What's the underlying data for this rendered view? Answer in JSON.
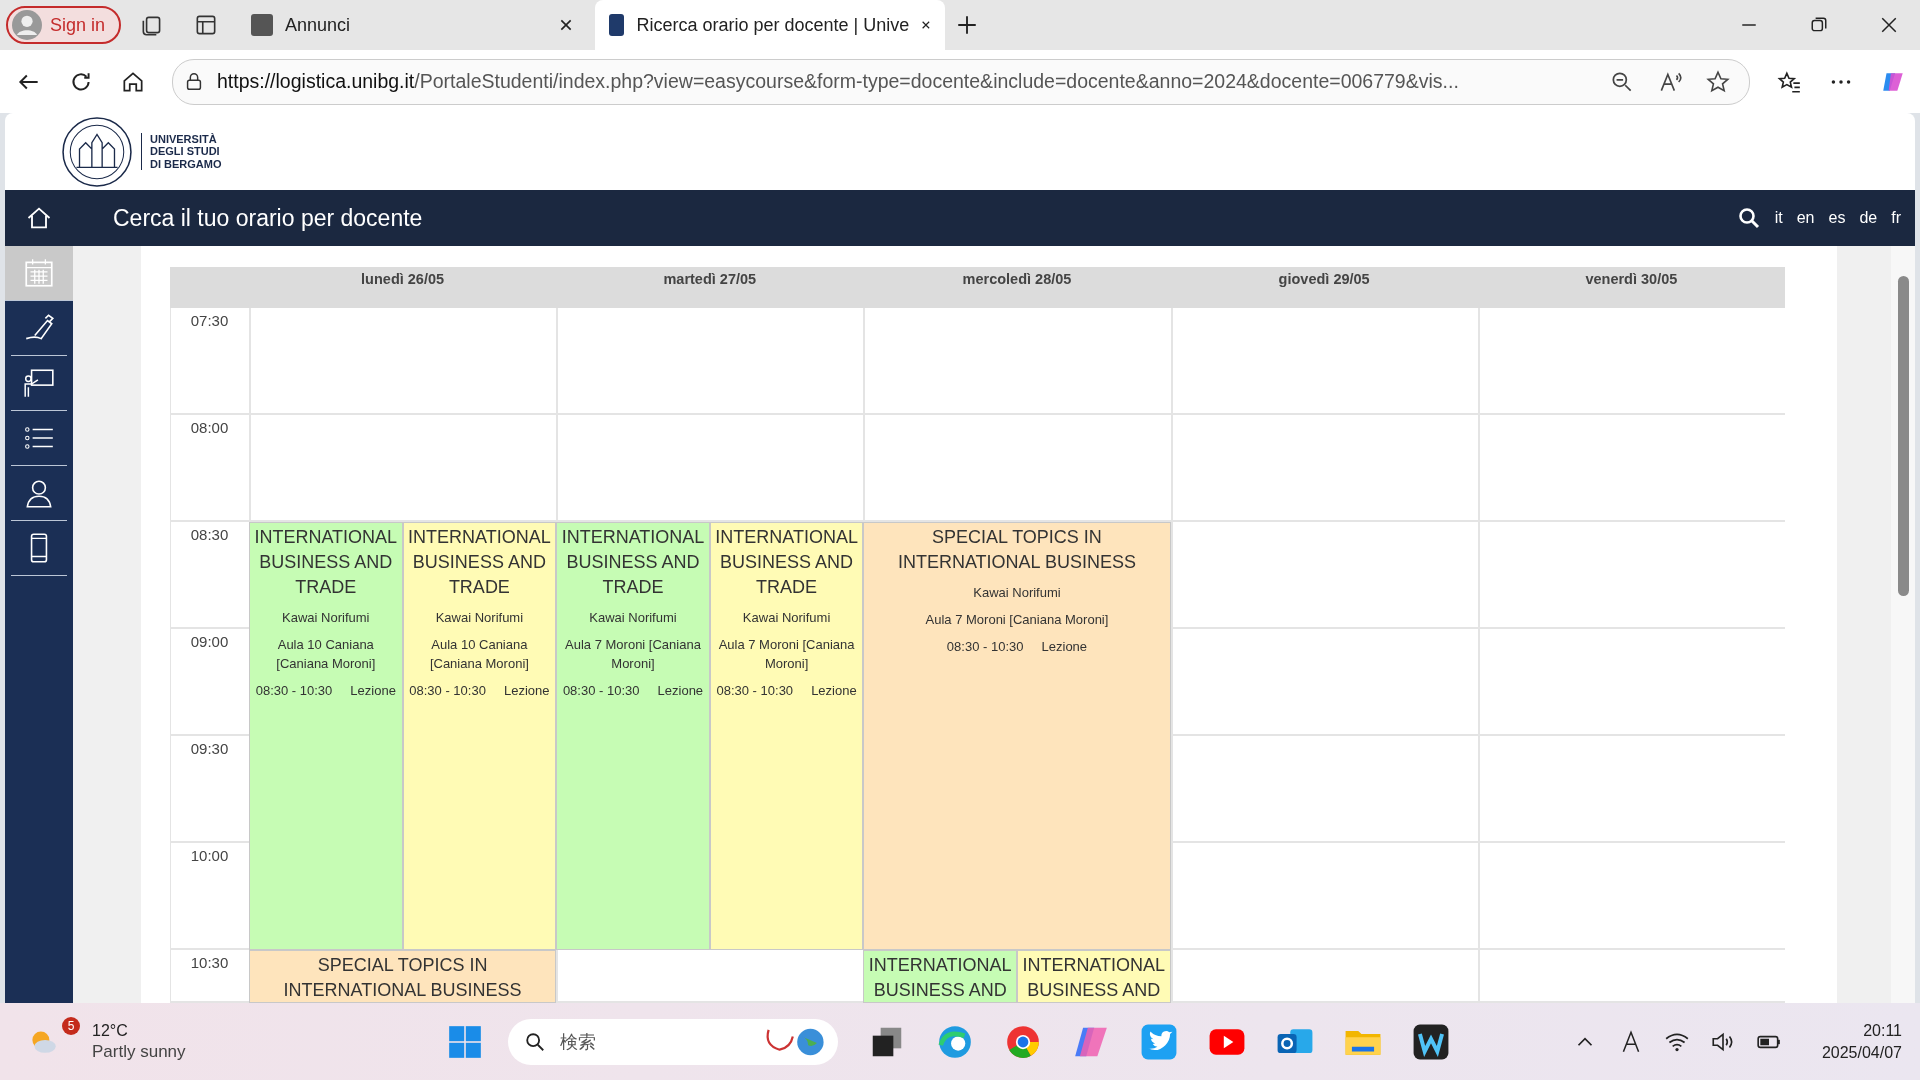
{
  "browser": {
    "sign_in": "Sign in",
    "tabs": [
      {
        "title": "Annunci",
        "selected": false
      },
      {
        "title": "Ricerca orario per docente | Unive",
        "selected": true
      }
    ],
    "url_host": "https://logistica.unibg.it",
    "url_rest": "/PortaleStudenti/index.php?view=easycourse&form-type=docente&include=docente&anno=2024&docente=006779&vis..."
  },
  "logo": {
    "text": "UNIVERSITÀ\nDEGLI STUDI\nDI BERGAMO"
  },
  "header": {
    "title": "Cerca il tuo orario per docente",
    "languages": [
      "it",
      "en",
      "es",
      "de",
      "fr"
    ]
  },
  "sidebar": {
    "items": [
      {
        "kind": "calendar",
        "selected": true
      },
      {
        "kind": "pen",
        "selected": false
      },
      {
        "kind": "board",
        "selected": false
      },
      {
        "kind": "list",
        "selected": false
      },
      {
        "kind": "person",
        "selected": false
      },
      {
        "kind": "phone",
        "selected": false
      }
    ]
  },
  "times": [
    "07:30",
    "08:00",
    "08:30",
    "09:00",
    "09:30",
    "10:00",
    "10:30"
  ],
  "days": [
    {
      "label": "lunedì 26/05",
      "blocks": [
        {
          "events": [
            {
              "color": "#c6fcb4",
              "title": "INTERNATIONAL BUSINESS AND TRADE",
              "teacher": "Kawai Norifumi",
              "room": "Aula 10 Caniana [Caniana Moroni]",
              "time": "08:30 - 10:30",
              "type": "Lezione"
            },
            {
              "color": "#fffbb5",
              "title": "INTERNATIONAL BUSINESS AND TRADE",
              "teacher": "Kawai Norifumi",
              "room": "Aula 10 Caniana [Caniana Moroni]",
              "time": "08:30 - 10:30",
              "type": "Lezione"
            }
          ]
        },
        {
          "events": [
            {
              "color": "#fee4bc",
              "title": "SPECIAL TOPICS IN INTERNATIONAL BUSINESS"
            }
          ]
        }
      ]
    },
    {
      "label": "martedì 27/05",
      "blocks": [
        {
          "events": [
            {
              "color": "#c6fcb4",
              "title": "INTERNATIONAL BUSINESS AND TRADE",
              "teacher": "Kawai Norifumi",
              "room": "Aula 7 Moroni [Caniana Moroni]",
              "time": "08:30 - 10:30",
              "type": "Lezione"
            },
            {
              "color": "#fffbb5",
              "title": "INTERNATIONAL BUSINESS AND TRADE",
              "teacher": "Kawai Norifumi",
              "room": "Aula 7 Moroni [Caniana Moroni]",
              "time": "08:30 - 10:30",
              "type": "Lezione"
            }
          ]
        }
      ]
    },
    {
      "label": "mercoledì 28/05",
      "blocks": [
        {
          "events": [
            {
              "color": "#fee4bc",
              "title": "SPECIAL TOPICS IN INTERNATIONAL BUSINESS",
              "teacher": "Kawai Norifumi",
              "room": "Aula 7 Moroni [Caniana Moroni]",
              "time": "08:30 - 10:30",
              "type": "Lezione"
            }
          ]
        },
        {
          "events": [
            {
              "color": "#c6fcb4",
              "title": "INTERNATIONAL BUSINESS AND"
            },
            {
              "color": "#fffbb5",
              "title": "INTERNATIONAL BUSINESS AND"
            }
          ]
        }
      ]
    },
    {
      "label": "giovedì 29/05"
    },
    {
      "label": "venerdì 30/05"
    }
  ],
  "taskbar": {
    "temperature": "12°C",
    "weather": "Partly sunny",
    "badge": "5",
    "search_placeholder": "検索",
    "time": "20:11",
    "date": "2025/04/07"
  }
}
